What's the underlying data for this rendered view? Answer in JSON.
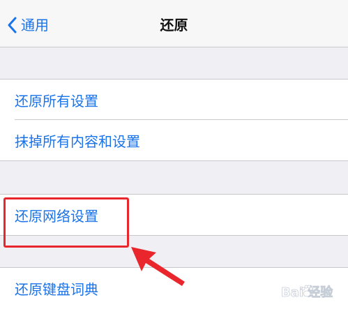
{
  "navbar": {
    "back_label": "通用",
    "title": "还原"
  },
  "groups": [
    {
      "items": [
        {
          "label": "还原所有设置"
        },
        {
          "label": "抹掉所有内容和设置"
        }
      ]
    },
    {
      "items": [
        {
          "label": "还原网络设置"
        }
      ]
    },
    {
      "items": [
        {
          "label": "还原键盘词典"
        }
      ]
    }
  ],
  "watermark": {
    "text": "Bai 经验",
    "icon": "baidu-paw-icon"
  },
  "colors": {
    "accent": "#1a73e8",
    "highlight": "#e8262b",
    "background": "#efeff4",
    "separator": "#c8c7cc"
  }
}
